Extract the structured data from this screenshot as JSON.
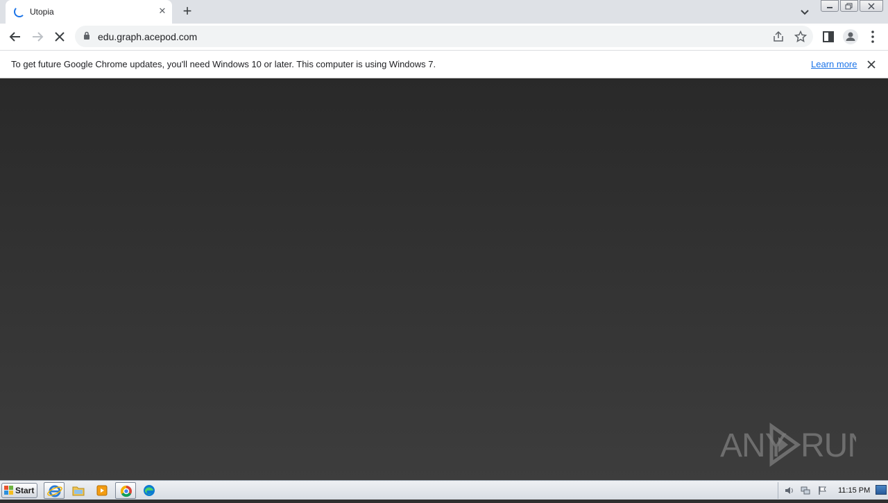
{
  "browser": {
    "tab": {
      "title": "Utopia",
      "close_glyph": "✕"
    },
    "new_tab_glyph": "+",
    "address": {
      "url": "edu.graph.acepod.com"
    }
  },
  "infobar": {
    "message": "To get future Google Chrome updates, you'll need Windows 10 or later. This computer is using Windows 7.",
    "link": "Learn more"
  },
  "watermark": {
    "text": "ANY RUN"
  },
  "taskbar": {
    "start_label": "Start",
    "clock": "11:15 PM",
    "apps": [
      "internet-explorer-icon",
      "file-explorer-icon",
      "media-player-icon",
      "chrome-icon",
      "edge-icon"
    ]
  },
  "colors": {
    "accent": "#1a73e8",
    "tabstrip": "#dee1e6",
    "content_top": "#292929",
    "content_bottom": "#3d3d3d"
  }
}
